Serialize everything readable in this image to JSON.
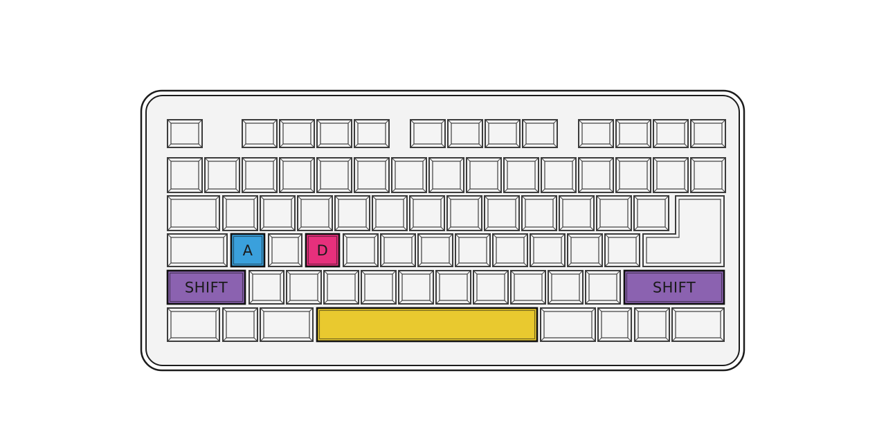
{
  "colors": {
    "key_default": "#f4f4f4",
    "key_outline": "#3c3c3c",
    "board_fill": "#f3f3f3",
    "board_outline": "#1c1c1c",
    "a_key": "#3aa0dc",
    "d_key": "#e6307c",
    "shift_key": "#8b62b0",
    "space_key": "#e9c92f"
  },
  "highlighted_keys": {
    "a_key": {
      "label": "A",
      "color": "a_key"
    },
    "d_key": {
      "label": "D",
      "color": "d_key"
    },
    "left_shift": {
      "label": "SHIFT",
      "color": "shift_key"
    },
    "right_shift": {
      "label": "SHIFT",
      "color": "shift_key"
    },
    "space_bar": {
      "label": "",
      "color": "space_key"
    }
  }
}
